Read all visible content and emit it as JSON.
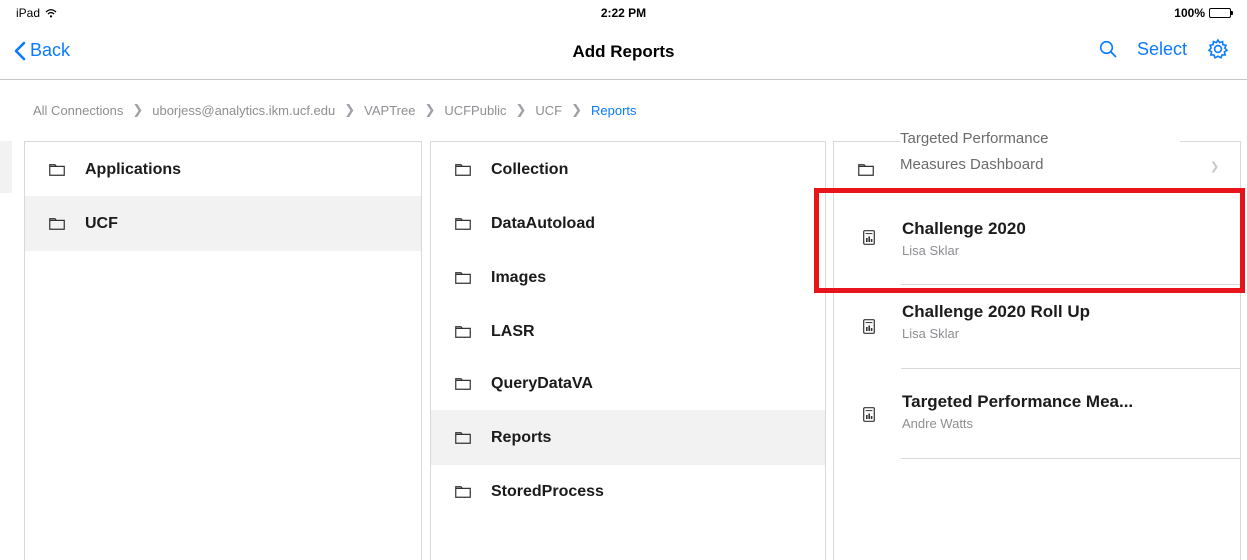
{
  "status_bar": {
    "device": "iPad",
    "time": "2:22 PM",
    "battery": "100%",
    "battery_level": 1.0,
    "wifi_icon": "wifi-icon",
    "battery_icon": "battery-icon"
  },
  "nav": {
    "back_label": "Back",
    "title": "Add Reports",
    "select_label": "Select",
    "search_icon": "search-icon",
    "settings_icon": "gear-icon",
    "accent": "#0a7aff"
  },
  "breadcrumb": {
    "items": [
      "All Connections",
      "uborjess@analytics.ikm.ucf.edu",
      "VAPTree",
      "UCFPublic",
      "UCF",
      "Reports"
    ]
  },
  "column1": {
    "items": [
      {
        "label": "Applications",
        "selected": false
      },
      {
        "label": "UCF",
        "selected": true
      }
    ]
  },
  "column2": {
    "items": [
      {
        "label": "Collection",
        "selected": false
      },
      {
        "label": "DataAutoload",
        "selected": false
      },
      {
        "label": "Images",
        "selected": false
      },
      {
        "label": "LASR",
        "selected": false
      },
      {
        "label": "QueryDataVA",
        "selected": false
      },
      {
        "label": "Reports",
        "selected": true
      },
      {
        "label": "StoredProcess",
        "selected": false
      }
    ]
  },
  "column3": {
    "annotation": [
      "Targeted Performance",
      "Measures Dashboard"
    ],
    "reports": [
      {
        "title": "Challenge 2020",
        "author": "Lisa Sklar",
        "highlighted": true
      },
      {
        "title": "Challenge 2020 Roll Up",
        "author": "Lisa Sklar",
        "highlighted": false
      },
      {
        "title": "Targeted Performance Mea...",
        "author": "Andre Watts",
        "highlighted": false
      }
    ]
  },
  "colors": {
    "highlight": "#e8141c",
    "selected_row": "#f2f2f2",
    "secondary_text": "#8e8e93"
  }
}
